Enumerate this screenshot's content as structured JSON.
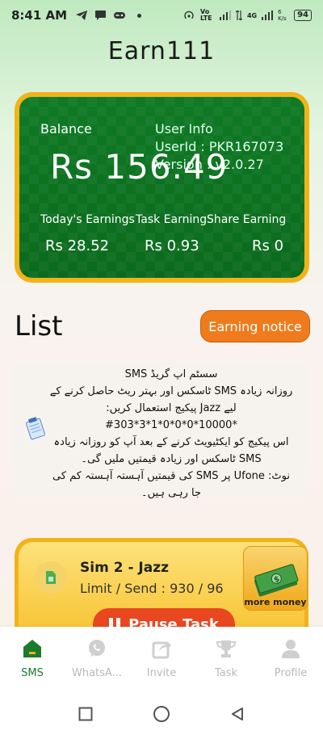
{
  "status_bar": {
    "time": "8:41 AM",
    "network_label": "Vo LTE",
    "network_type": "4G",
    "speed": "6 K/s",
    "battery": "94"
  },
  "app": {
    "title": "Earn111"
  },
  "balance_card": {
    "balance_label": "Balance",
    "balance_amount": "Rs 156.49",
    "user_info_label": "User Info",
    "user_id": "UserId : PKR167073",
    "version": "Version : v2.0.27",
    "stats": [
      {
        "label": "Today's Earnings",
        "value": "Rs 28.52"
      },
      {
        "label": "Task Earning",
        "value": "Rs 0.93"
      },
      {
        "label": "Share Earning",
        "value": "Rs 0"
      }
    ]
  },
  "list": {
    "title": "List",
    "notice_button": "Earning notice"
  },
  "notice": {
    "lines": [
      "سسٹم اپ گریڈ SMS",
      "روزانہ زیادہ SMS ٹاسکس اور بہتر ریٹ حاصل کرنے کے",
      "لیے Jazz پیکیج استعمال کریں:",
      "#303*3*1*0*0*0*10000*",
      "اس پیکیج کو ایکٹیویٹ کرنے کے بعد آپ کو روزانہ زیادہ",
      "SMS ٹاسکس اور زیادہ قیمتیں ملیں گی۔",
      "نوٹ: Ufone پر SMS کی قیمتیں آہستہ آہستہ کم کی",
      "جا رہی ہیں۔"
    ]
  },
  "sim_card": {
    "name": "Sim 2 - Jazz",
    "limit_send": "Limit / Send : 930 / 96",
    "badge": "more money",
    "pause_button": "Pause Task"
  },
  "bottom_nav": [
    {
      "label": "SMS",
      "icon": "sms-icon",
      "active": true
    },
    {
      "label": "WhatsA...",
      "icon": "whatsapp-icon",
      "active": false
    },
    {
      "label": "Invite",
      "icon": "share-icon",
      "active": false
    },
    {
      "label": "Task",
      "icon": "trophy-icon",
      "active": false
    },
    {
      "label": "Profile",
      "icon": "person-icon",
      "active": false
    }
  ],
  "colors": {
    "accent_green": "#0d6e20",
    "gold": "#f2b319",
    "orange": "#f07b1d",
    "red": "#e8471f"
  }
}
